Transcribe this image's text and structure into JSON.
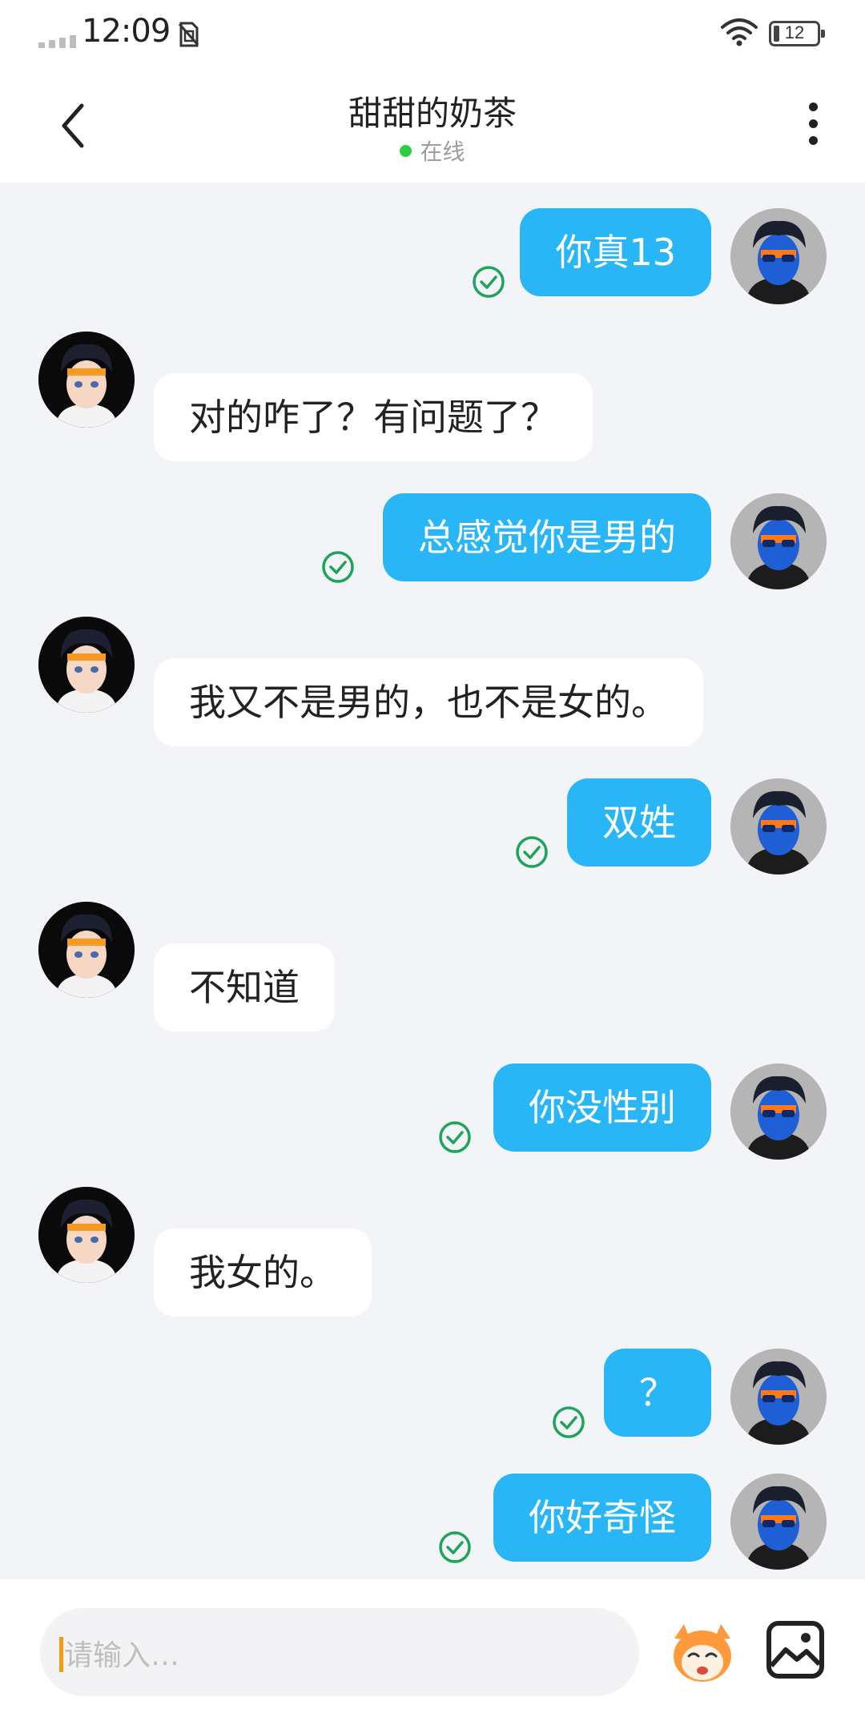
{
  "status_bar": {
    "time": "12:09",
    "battery": "12"
  },
  "header": {
    "title": "甜甜的奶茶",
    "status": "在线"
  },
  "messages": [
    {
      "side": "mine",
      "text": "你真13"
    },
    {
      "side": "theirs",
      "text": "对的咋了？有问题了？"
    },
    {
      "side": "mine",
      "text": "总感觉你是男的"
    },
    {
      "side": "theirs",
      "text": "我又不是男的，也不是女的。"
    },
    {
      "side": "mine",
      "text": "双姓"
    },
    {
      "side": "theirs",
      "text": "不知道"
    },
    {
      "side": "mine",
      "text": "你没性别"
    },
    {
      "side": "theirs",
      "text": "我女的。"
    },
    {
      "side": "mine",
      "text": "？"
    },
    {
      "side": "mine",
      "text": "你好奇怪"
    }
  ],
  "input": {
    "placeholder": "请输入…"
  },
  "icons": {
    "back": "chevron-left-icon",
    "more": "more-vertical-icon",
    "emoji": "emoji-sticker-icon",
    "image": "image-icon",
    "read_receipt": "check-circle-icon"
  },
  "colors": {
    "my_bubble": "#29b6f6",
    "their_bubble": "#ffffff",
    "chat_background": "#f2f4f8",
    "read_check": "#1ea35a",
    "online_dot": "#2ecc40"
  }
}
